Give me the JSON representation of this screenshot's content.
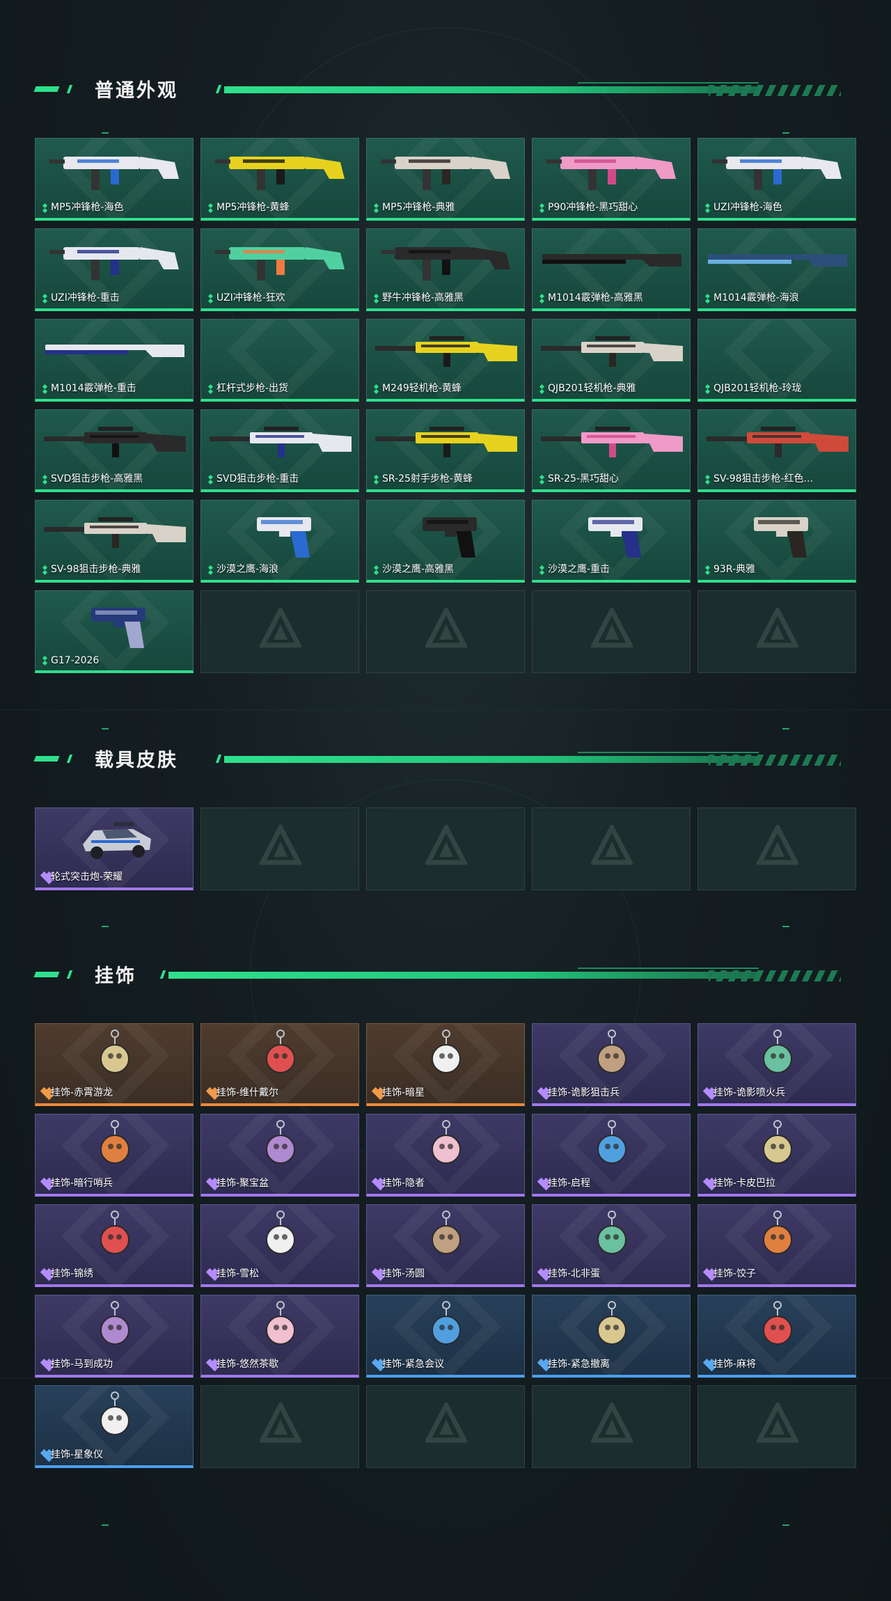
{
  "sections": {
    "weapons": {
      "title": "普通外观",
      "items": [
        {
          "label": "MP5冲锋枪-海色",
          "rarity": "green",
          "icon": "smg-white-blue"
        },
        {
          "label": "MP5冲锋枪-黄蜂",
          "rarity": "green",
          "icon": "smg-yellow-black"
        },
        {
          "label": "MP5冲锋枪-典雅",
          "rarity": "green",
          "icon": "smg-white-dark"
        },
        {
          "label": "P90冲锋枪-黑巧甜心",
          "rarity": "green",
          "icon": "smg-pink"
        },
        {
          "label": "UZI冲锋枪-海色",
          "rarity": "green",
          "icon": "smg-white-blue"
        },
        {
          "label": "UZI冲锋枪-重击",
          "rarity": "green",
          "icon": "smg-white-navy"
        },
        {
          "label": "UZI冲锋枪-狂欢",
          "rarity": "green",
          "icon": "smg-colorful"
        },
        {
          "label": "野牛冲锋枪-高雅黑",
          "rarity": "green",
          "icon": "smg-black"
        },
        {
          "label": "M1014霰弹枪-高雅黑",
          "rarity": "green",
          "icon": "shotgun-black"
        },
        {
          "label": "M1014霰弹枪-海浪",
          "rarity": "green",
          "icon": "shotgun-blue"
        },
        {
          "label": "M1014霰弹枪-重击",
          "rarity": "green",
          "icon": "shotgun-white-navy"
        },
        {
          "label": "杠杆式步枪-出货",
          "rarity": "green",
          "icon": "rifle-none"
        },
        {
          "label": "M249轻机枪-黄蜂",
          "rarity": "green",
          "icon": "lmg-yellow-black"
        },
        {
          "label": "QJB201轻机枪-典雅",
          "rarity": "green",
          "icon": "lmg-white-dark"
        },
        {
          "label": "QJB201轻机枪-玲珑",
          "rarity": "green",
          "icon": "lmg-none"
        },
        {
          "label": "SVD狙击步枪-高雅黑",
          "rarity": "green",
          "icon": "sniper-black"
        },
        {
          "label": "SVD狙击步枪-重击",
          "rarity": "green",
          "icon": "sniper-white-navy"
        },
        {
          "label": "SR-25射手步枪-黄蜂",
          "rarity": "green",
          "icon": "sniper-yellow-black"
        },
        {
          "label": "SR-25-黑巧甜心",
          "rarity": "green",
          "icon": "rifle-pink"
        },
        {
          "label": "SV-98狙击步枪-红色...",
          "rarity": "green",
          "icon": "sniper-red"
        },
        {
          "label": "SV-98狙击步枪-典雅",
          "rarity": "green",
          "icon": "sniper-white-dark"
        },
        {
          "label": "沙漠之鹰-海浪",
          "rarity": "green",
          "icon": "pistol-white-blue"
        },
        {
          "label": "沙漠之鹰-高雅黑",
          "rarity": "green",
          "icon": "pistol-black"
        },
        {
          "label": "沙漠之鹰-重击",
          "rarity": "green",
          "icon": "pistol-white-navy"
        },
        {
          "label": "93R-典雅",
          "rarity": "green",
          "icon": "pistol-white-dark"
        },
        {
          "label": "G17-2026",
          "rarity": "green",
          "icon": "pistol-navy"
        },
        {
          "label": "",
          "rarity": "empty"
        },
        {
          "label": "",
          "rarity": "empty"
        },
        {
          "label": "",
          "rarity": "empty"
        },
        {
          "label": "",
          "rarity": "empty"
        }
      ]
    },
    "vehicles": {
      "title": "载具皮肤",
      "items": [
        {
          "label": "轮式突击炮-荣耀",
          "rarity": "purple",
          "icon": "vehicle-icon"
        },
        {
          "label": "",
          "rarity": "empty"
        },
        {
          "label": "",
          "rarity": "empty"
        },
        {
          "label": "",
          "rarity": "empty"
        },
        {
          "label": "",
          "rarity": "empty"
        }
      ]
    },
    "charms": {
      "title": "挂饰",
      "items": [
        {
          "label": "挂饰-赤霄游龙",
          "rarity": "orange",
          "icon": "charm-icon"
        },
        {
          "label": "挂饰-维什戴尔",
          "rarity": "orange",
          "icon": "charm-icon"
        },
        {
          "label": "挂饰-暗星",
          "rarity": "orange",
          "icon": "charm-icon"
        },
        {
          "label": "挂饰-诡影狙击兵",
          "rarity": "purple",
          "icon": "charm-icon"
        },
        {
          "label": "挂饰-诡影喷火兵",
          "rarity": "purple",
          "icon": "charm-icon"
        },
        {
          "label": "挂饰-暗行哨兵",
          "rarity": "purple",
          "icon": "charm-icon"
        },
        {
          "label": "挂饰-聚宝盆",
          "rarity": "purple",
          "icon": "charm-icon"
        },
        {
          "label": "挂饰-隐者",
          "rarity": "purple",
          "icon": "charm-icon"
        },
        {
          "label": "挂饰-启程",
          "rarity": "purple",
          "icon": "charm-icon"
        },
        {
          "label": "挂饰-卡皮巴拉",
          "rarity": "purple",
          "icon": "charm-icon"
        },
        {
          "label": "挂饰-锦绣",
          "rarity": "purple",
          "icon": "charm-icon"
        },
        {
          "label": "挂饰-雪松",
          "rarity": "purple",
          "icon": "charm-icon"
        },
        {
          "label": "挂饰-汤圆",
          "rarity": "purple",
          "icon": "charm-icon"
        },
        {
          "label": "挂饰-北非蛋",
          "rarity": "purple",
          "icon": "charm-icon"
        },
        {
          "label": "挂饰-饺子",
          "rarity": "purple",
          "icon": "charm-icon"
        },
        {
          "label": "挂饰-马到成功",
          "rarity": "purple",
          "icon": "charm-icon"
        },
        {
          "label": "挂饰-悠然茶歇",
          "rarity": "purple",
          "icon": "charm-icon"
        },
        {
          "label": "挂饰-紧急会议",
          "rarity": "blue",
          "icon": "charm-icon"
        },
        {
          "label": "挂饰-紧急撤离",
          "rarity": "blue",
          "icon": "charm-icon"
        },
        {
          "label": "挂饰-麻将",
          "rarity": "blue",
          "icon": "charm-icon"
        },
        {
          "label": "挂饰-星象仪",
          "rarity": "blue",
          "icon": "charm-icon"
        },
        {
          "label": "",
          "rarity": "empty"
        },
        {
          "label": "",
          "rarity": "empty"
        },
        {
          "label": "",
          "rarity": "empty"
        },
        {
          "label": "",
          "rarity": "empty"
        }
      ]
    }
  },
  "colors": {
    "accent": "#2ee08c",
    "green": "#2ee08c",
    "purple": "#a178f0",
    "orange": "#f08a3a",
    "blue": "#4aa0f0"
  }
}
